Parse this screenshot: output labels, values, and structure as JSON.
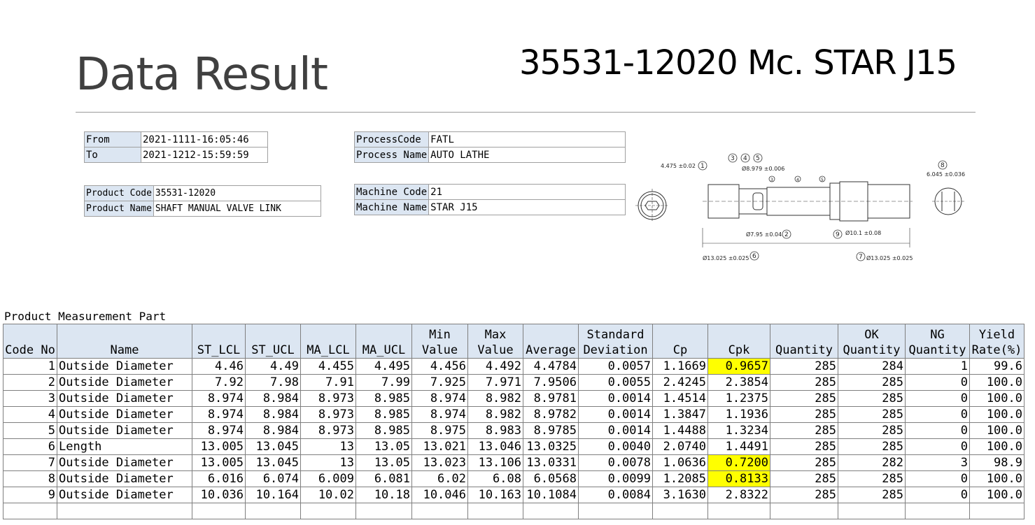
{
  "header": {
    "title": "Data Result",
    "subtitle": "35531-12020 Mc. STAR J15"
  },
  "period": {
    "from_label": "From",
    "from_value": "2021-1111-16:05:46",
    "to_label": "To",
    "to_value": "2021-1212-15:59:59"
  },
  "product": {
    "code_label": "Product Code",
    "code_value": "35531-12020",
    "name_label": "Product Name",
    "name_value": "SHAFT MANUAL VALVE LINK"
  },
  "process": {
    "code_label": "ProcessCode",
    "code_value": "FATL",
    "name_label": "Process Name",
    "name_value": "AUTO LATHE"
  },
  "machine": {
    "code_label": "Machine Code",
    "code_value": "21",
    "name_label": "Machine Name",
    "name_value": "STAR J15"
  },
  "drawing": {
    "dims": [
      "4.475 ±0.02",
      "Ø8.979 ±0.006",
      "6.045 ±0.036",
      "Ø7.95 ±0.04",
      "Ø10.1 ±0.08",
      "Ø13.025 ±0.025",
      "Ø13.025 ±0.025"
    ],
    "markers": [
      "1",
      "3",
      "4",
      "5",
      "8",
      "2",
      "9",
      "6",
      "7",
      "3",
      "4",
      "5"
    ]
  },
  "measurement": {
    "section_title": "Product Measurement Part",
    "columns": [
      "Code No",
      "Name",
      "ST_LCL",
      "ST_UCL",
      "MA_LCL",
      "MA_UCL",
      "Min Value",
      "Max Value",
      "Average",
      "Standard Deviation",
      "Cp",
      "Cpk",
      "Quantity",
      "OK Quantity",
      "NG Quantity",
      "Yield Rate(%)"
    ],
    "rows": [
      [
        "1",
        "Outside Diameter",
        "4.46",
        "4.49",
        "4.455",
        "4.495",
        "4.456",
        "4.492",
        "4.4784",
        "0.0057",
        "1.1669",
        "0.9657",
        "285",
        "284",
        "1",
        "99.6"
      ],
      [
        "2",
        "Outside Diameter",
        "7.92",
        "7.98",
        "7.91",
        "7.99",
        "7.925",
        "7.971",
        "7.9506",
        "0.0055",
        "2.4245",
        "2.3854",
        "285",
        "285",
        "0",
        "100.0"
      ],
      [
        "3",
        "Outside Diameter",
        "8.974",
        "8.984",
        "8.973",
        "8.985",
        "8.974",
        "8.982",
        "8.9781",
        "0.0014",
        "1.4514",
        "1.2375",
        "285",
        "285",
        "0",
        "100.0"
      ],
      [
        "4",
        "Outside Diameter",
        "8.974",
        "8.984",
        "8.973",
        "8.985",
        "8.974",
        "8.982",
        "8.9782",
        "0.0014",
        "1.3847",
        "1.1936",
        "285",
        "285",
        "0",
        "100.0"
      ],
      [
        "5",
        "Outside Diameter",
        "8.974",
        "8.984",
        "8.973",
        "8.985",
        "8.975",
        "8.983",
        "8.9785",
        "0.0014",
        "1.4488",
        "1.3234",
        "285",
        "285",
        "0",
        "100.0"
      ],
      [
        "6",
        "Length",
        "13.005",
        "13.045",
        "13",
        "13.05",
        "13.021",
        "13.046",
        "13.0325",
        "0.0040",
        "2.0740",
        "1.4491",
        "285",
        "285",
        "0",
        "100.0"
      ],
      [
        "7",
        "Outside Diameter",
        "13.005",
        "13.045",
        "13",
        "13.05",
        "13.023",
        "13.106",
        "13.0331",
        "0.0078",
        "1.0636",
        "0.7200",
        "285",
        "282",
        "3",
        "98.9"
      ],
      [
        "8",
        "Outside Diameter",
        "6.016",
        "6.074",
        "6.009",
        "6.081",
        "6.02",
        "6.08",
        "6.0568",
        "0.0099",
        "1.2085",
        "0.8133",
        "285",
        "285",
        "0",
        "100.0"
      ],
      [
        "9",
        "Outside Diameter",
        "10.036",
        "10.164",
        "10.02",
        "10.18",
        "10.046",
        "10.163",
        "10.1084",
        "0.0084",
        "3.1630",
        "2.8322",
        "285",
        "285",
        "0",
        "100.0"
      ]
    ],
    "highlighted_cpk_rows": [
      0,
      6,
      7
    ],
    "highlight_color": "#ffff00",
    "header_color": "#dce6f2"
  }
}
